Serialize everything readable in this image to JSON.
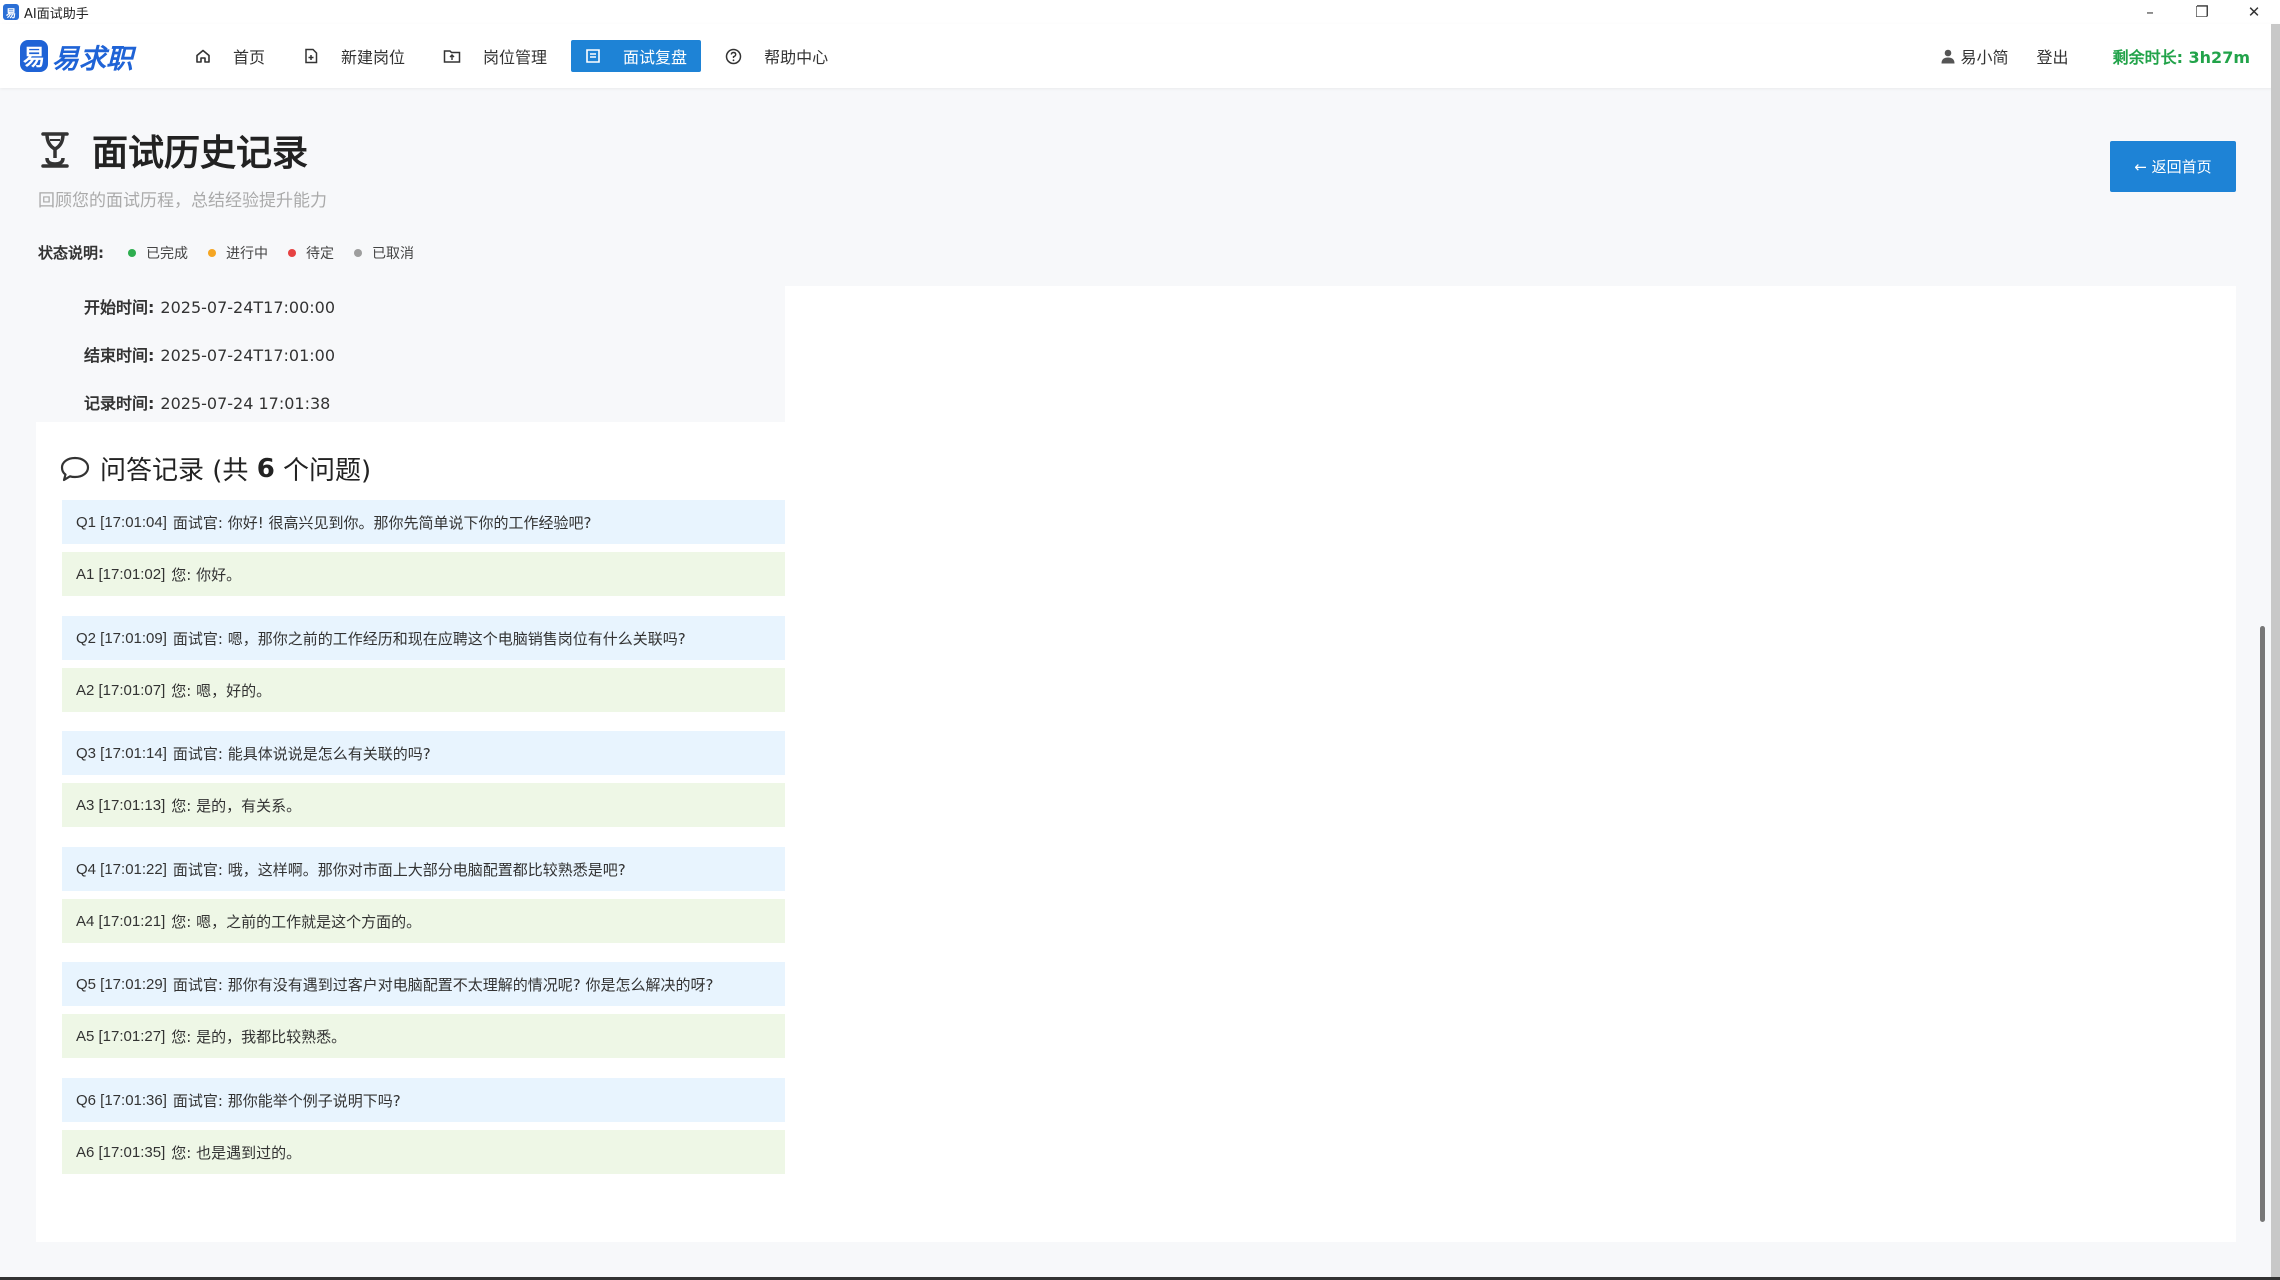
{
  "window": {
    "title": "AI面试助手",
    "app_icon": "易",
    "controls": [
      "–",
      "❐",
      "✕"
    ]
  },
  "navbar": {
    "logo_mark": "易",
    "logo_text": "易求职",
    "items": [
      {
        "label": "首页",
        "icon": "home-icon"
      },
      {
        "label": "新建岗位",
        "icon": "new-file-icon"
      },
      {
        "label": "岗位管理",
        "icon": "folder-icon"
      },
      {
        "label": "面试复盘",
        "icon": "review-icon",
        "active": true
      },
      {
        "label": "帮助中心",
        "icon": "help-icon"
      }
    ],
    "user": "易小简",
    "logout": "登出",
    "remaining": "剩余时长: 3h27m"
  },
  "header": {
    "title": "面试历史记录",
    "subtitle": "回顾您的面试历程，总结经验提升能力",
    "back_button": "← 返回首页"
  },
  "status_legend": {
    "label": "状态说明:",
    "items": [
      {
        "label": "已完成",
        "color": "#2eae4f"
      },
      {
        "label": "进行中",
        "color": "#f5a623"
      },
      {
        "label": "待定",
        "color": "#e64242"
      },
      {
        "label": "已取消",
        "color": "#9e9e9e"
      }
    ]
  },
  "meta": {
    "start_label": "开始时间:",
    "start_value": "2025-07-24T17:00:00",
    "end_label": "结束时间:",
    "end_value": "2025-07-24T17:01:00",
    "record_label": "记录时间:",
    "record_value": "2025-07-24 17:01:38"
  },
  "qa": {
    "title_prefix": "问答记录 (共",
    "count": "6",
    "title_suffix": "个问题)",
    "items": [
      {
        "ts": "Q1 [17:01:04]",
        "text": "面试官: 你好! 很高兴见到你。那你先简单说下你的工作经验吧?"
      },
      {
        "ts": "A1 [17:01:02]",
        "text": "您: 你好。"
      },
      {
        "ts": "Q2 [17:01:09]",
        "text": "面试官: 嗯，那你之前的工作经历和现在应聘这个电脑销售岗位有什么关联吗?"
      },
      {
        "ts": "A2 [17:01:07]",
        "text": "您: 嗯，好的。"
      },
      {
        "ts": "Q3 [17:01:14]",
        "text": "面试官: 能具体说说是怎么有关联的吗?"
      },
      {
        "ts": "A3 [17:01:13]",
        "text": "您: 是的，有关系。"
      },
      {
        "ts": "Q4 [17:01:22]",
        "text": "面试官: 哦，这样啊。那你对市面上大部分电脑配置都比较熟悉是吧?"
      },
      {
        "ts": "A4 [17:01:21]",
        "text": "您: 嗯，之前的工作就是这个方面的。"
      },
      {
        "ts": "Q5 [17:01:29]",
        "text": "面试官: 那你有没有遇到过客户对电脑配置不太理解的情况呢? 你是怎么解决的呀?"
      },
      {
        "ts": "A5 [17:01:27]",
        "text": "您: 是的，我都比较熟悉。"
      },
      {
        "ts": "Q6 [17:01:36]",
        "text": "面试官: 那你能举个例子说明下吗?"
      },
      {
        "ts": "A6 [17:01:35]",
        "text": "您: 也是遇到过的。"
      }
    ]
  }
}
